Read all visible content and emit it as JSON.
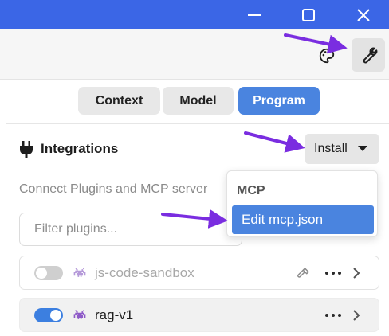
{
  "tabs": [
    {
      "label": "Context"
    },
    {
      "label": "Model"
    },
    {
      "label": "Program",
      "active": true
    }
  ],
  "integrations": {
    "title": "Integrations",
    "install_label": "Install",
    "description": "Connect Plugins and MCP server"
  },
  "filter": {
    "placeholder": "Filter plugins..."
  },
  "plugins": [
    {
      "name": "js-code-sandbox",
      "enabled": false
    },
    {
      "name": "rag-v1",
      "enabled": true
    }
  ],
  "menu": {
    "header": "MCP",
    "items": [
      {
        "label": "Edit mcp.json"
      }
    ]
  },
  "icons": {
    "toolbar": [
      "palette-icon",
      "wrench-icon"
    ],
    "window": [
      "minimize-icon",
      "maximize-icon",
      "close-icon"
    ],
    "section": "plug-icon",
    "plugin": "space-invader-icon"
  },
  "colors": {
    "titlebar": "#3b66e6",
    "accent": "#4a84df",
    "toggle_on": "#3c7fe0",
    "plugin_icon": "#8e5ac8",
    "annotation_arrow": "#7a2de0"
  }
}
